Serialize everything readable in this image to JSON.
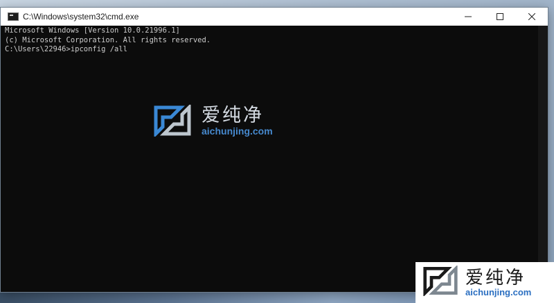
{
  "window": {
    "title": "C:\\Windows\\system32\\cmd.exe",
    "app_icon": "cmd-icon"
  },
  "caption_buttons": {
    "minimize_icon": "minimize-icon",
    "maximize_icon": "maximize-icon",
    "close_icon": "close-icon"
  },
  "console": {
    "lines": [
      "Microsoft Windows [Version 10.0.21996.1]",
      "(c) Microsoft Corporation. All rights reserved.",
      "",
      "C:\\Users\\22946>ipconfig /all"
    ],
    "text_color": "#cccccc",
    "background": "#0c0c0c"
  },
  "watermark": {
    "chinese_text": "爱纯净",
    "url_text": "aichunjing.com",
    "url_color": "#4a90d9"
  },
  "corner_badge": {
    "chinese_text": "爱纯净",
    "url_text": "aichunjing.com"
  }
}
